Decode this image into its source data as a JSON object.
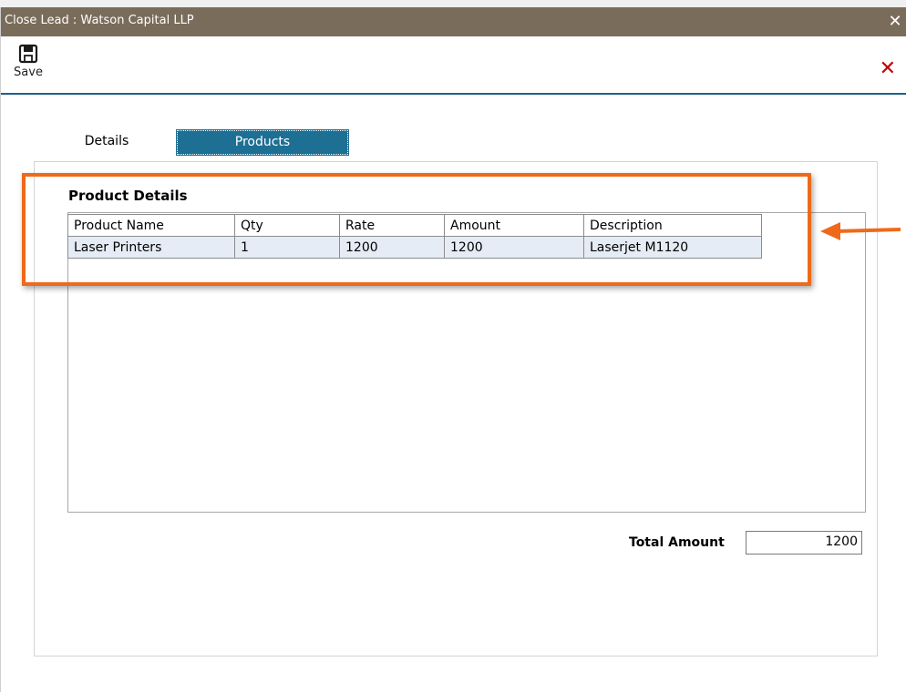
{
  "window": {
    "title": "Close Lead : Watson Capital LLP",
    "close_glyph": "✕"
  },
  "toolbar": {
    "save_label": "Save",
    "save_icon": "save-icon",
    "close_glyph": "✕"
  },
  "tabs": [
    {
      "label": "Details",
      "active": false
    },
    {
      "label": "Products",
      "active": true
    }
  ],
  "product_details": {
    "title": "Product Details",
    "columns": [
      "Product Name",
      "Qty",
      "Rate",
      "Amount",
      "Description"
    ],
    "rows": [
      [
        "Laser Printers",
        "1",
        "1200",
        "1200",
        "Laserjet M1120"
      ]
    ]
  },
  "totals": {
    "label": "Total Amount",
    "value": "1200"
  },
  "colors": {
    "titlebar": "#7a6c5b",
    "active_tab": "#1d6f93",
    "highlight": "#ee6a1a",
    "close_red": "#c00000",
    "row_bg": "#e6ecf5"
  }
}
